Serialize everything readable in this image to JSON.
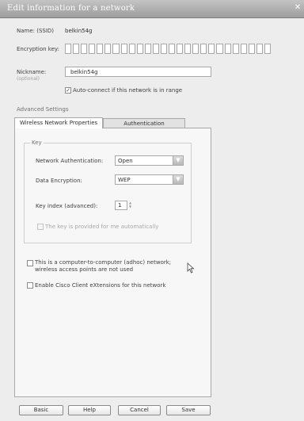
{
  "window": {
    "title": "Edit information for a network",
    "close_glyph": "✕"
  },
  "network": {
    "name_label": "Name: (SSID)",
    "name_value": "belkin54g",
    "encryption_key_label": "Encryption key:",
    "nickname_label": "Nickname:",
    "nickname_hint": "(optional)",
    "nickname_value": "belkin54g",
    "autoconnect_label": "Auto-connect if this network is in range",
    "autoconnect_checked": true
  },
  "advanced": {
    "heading": "Advanced Settings",
    "tabs": [
      {
        "label": "Wireless Network Properties",
        "active": true
      },
      {
        "label": "Authentication",
        "active": false
      }
    ]
  },
  "key_group": {
    "legend": "Key",
    "auth_label": "Network Authentication:",
    "auth_value": "Open",
    "encryption_label": "Data Encryption:",
    "encryption_value": "WEP",
    "key_index_label": "Key index (advanced):",
    "key_index_value": "1",
    "auto_key_label": "The key is provided for me automatically"
  },
  "options": {
    "adhoc_line1": "This is a computer-to-computer (adhoc) network;",
    "adhoc_line2": "wireless access points are not used",
    "cisco_label": "Enable Cisco Client eXtensions for this network"
  },
  "buttons": {
    "basic": "Basic",
    "help": "Help",
    "cancel": "Cancel",
    "save": "Save"
  },
  "icons": {
    "dropdown": "chevron-down-icon",
    "cursor": "mouse-pointer-icon",
    "check": "checkmark-icon"
  }
}
